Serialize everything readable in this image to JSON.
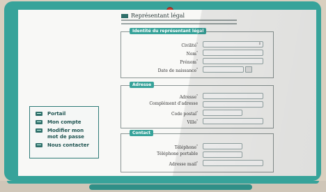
{
  "page": {
    "section_title": "Représentant légal"
  },
  "identity": {
    "legend": "Identité du représentant légal",
    "civilite_label": "Civilité",
    "nom_label": "Nom",
    "prenom_label": "Prénom",
    "naissance_label": "Date de naissance",
    "required_mark": "*"
  },
  "address": {
    "legend": "Adresse",
    "adresse_label": "Adresse",
    "complement_label": "Complément d'adresse",
    "cp_label": "Code postal",
    "ville_label": "Ville"
  },
  "contact": {
    "legend": "Contact",
    "tel_label": "Téléphone",
    "mobile_label": "Téléphone portable",
    "mail_label": "Adresse mail"
  },
  "menu": {
    "items": [
      {
        "label": "Portail",
        "icon": "monitor-icon"
      },
      {
        "label": "Mon compte",
        "icon": "monitor-icon"
      },
      {
        "label": "Modifier mon",
        "label2": "mot de passe",
        "icon": "monitor-icon"
      },
      {
        "label": "Nous contacter",
        "icon": "monitor-icon"
      }
    ]
  },
  "colors": {
    "accent": "#37a39a",
    "background": "#d9cfbf",
    "camera": "#c0392b"
  }
}
